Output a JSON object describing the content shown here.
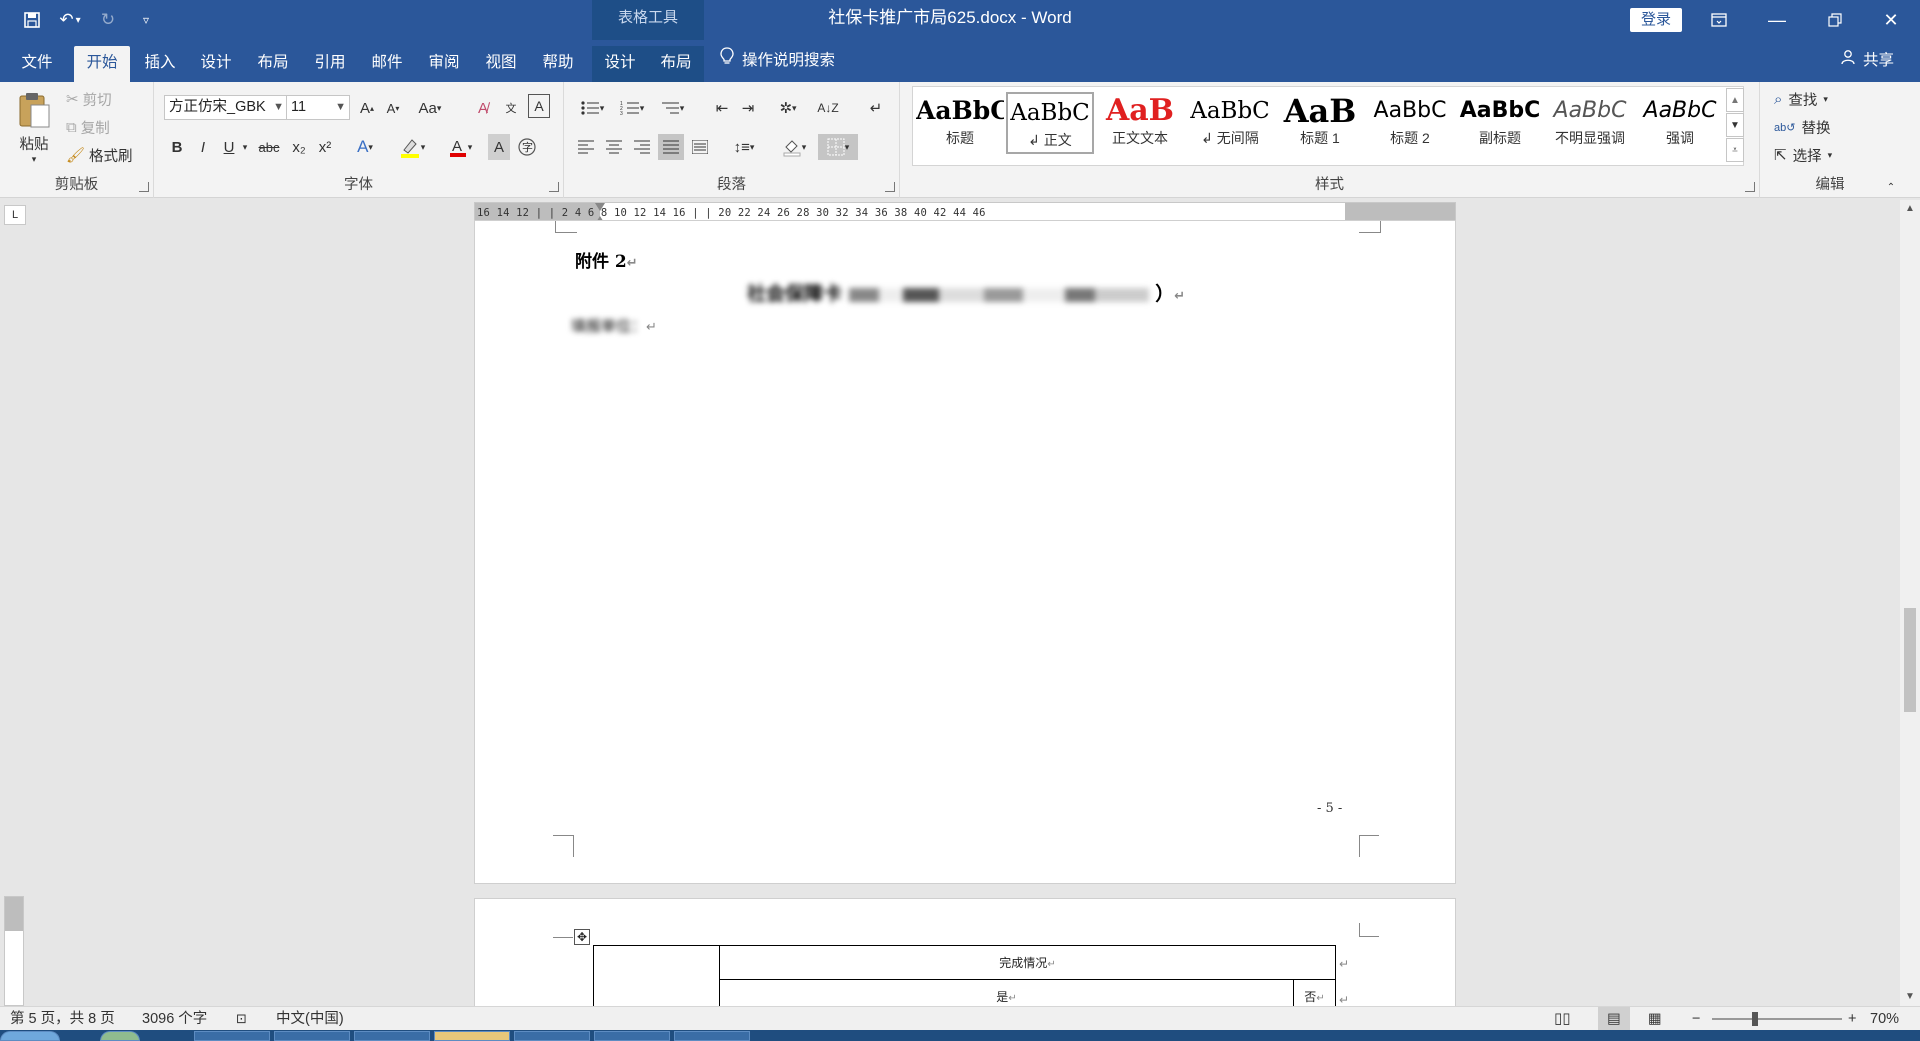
{
  "title_bar": {
    "document_title": "社保卡推广市局625.docx - Word",
    "context_tab_group": "表格工具",
    "login_label": "登录",
    "qat_icons": [
      "save-icon",
      "undo-icon",
      "redo-icon",
      "customize-qat-icon"
    ],
    "window_icons": [
      "ribbon-display-icon",
      "minimize-icon",
      "restore-icon",
      "close-icon"
    ]
  },
  "tabs": [
    {
      "label": "文件",
      "active": false
    },
    {
      "label": "开始",
      "active": true
    },
    {
      "label": "插入",
      "active": false
    },
    {
      "label": "设计",
      "active": false
    },
    {
      "label": "布局",
      "active": false
    },
    {
      "label": "引用",
      "active": false
    },
    {
      "label": "邮件",
      "active": false
    },
    {
      "label": "审阅",
      "active": false
    },
    {
      "label": "视图",
      "active": false
    },
    {
      "label": "帮助",
      "active": false
    },
    {
      "label": "设计",
      "active": false
    },
    {
      "label": "布局",
      "active": false
    }
  ],
  "tell_me": "操作说明搜索",
  "share": "共享",
  "ribbon": {
    "clipboard": {
      "label": "剪贴板",
      "paste": "粘贴",
      "cut": "剪切",
      "copy": "复制",
      "format_painter": "格式刷"
    },
    "font": {
      "label": "字体",
      "font_name": "方正仿宋_GBK",
      "font_size": "11",
      "change_case": "Aa",
      "bold": "B",
      "italic": "I",
      "underline": "U",
      "strike": "abc",
      "subscript": "x₂",
      "superscript": "x²"
    },
    "paragraph": {
      "label": "段落"
    },
    "styles": {
      "label": "样式",
      "items": [
        {
          "sample": "AaBbC(",
          "name": "标题"
        },
        {
          "sample": "AaBbC",
          "name": "↲ 正文"
        },
        {
          "sample": "AaB",
          "name": "正文文本"
        },
        {
          "sample": "AaBbC",
          "name": "↲ 无间隔"
        },
        {
          "sample": "AaB",
          "name": "标题 1"
        },
        {
          "sample": "AaBbC",
          "name": "标题 2"
        },
        {
          "sample": "AaBbC",
          "name": "副标题"
        },
        {
          "sample": "AaBbC",
          "name": "不明显强调"
        },
        {
          "sample": "AaBbC",
          "name": "强调"
        }
      ]
    },
    "editing": {
      "label": "编辑",
      "find": "查找",
      "replace": "替换",
      "select": "选择"
    }
  },
  "ruler": {
    "corner": "L",
    "ticks": "16  14  12  |  |  2  4  6  8  10  12  14  16  |  |  20  22  24  26  28  30  32  34  36  38  40  42  44  46"
  },
  "document": {
    "page1": {
      "attachment_label": "附件 2",
      "title_visible": "社会保障卡",
      "title_tail": "）",
      "unit_line": "填报单位：",
      "page_number": "- 5 -"
    },
    "page2": {
      "table_header": "完成情况",
      "col_yes": "是",
      "col_no": "否"
    }
  },
  "status_bar": {
    "page_info": "第 5 页，共 8 页",
    "word_count": "3096 个字",
    "language": "中文(中国)",
    "zoom": "70%",
    "zoom_fraction": 0.33
  }
}
